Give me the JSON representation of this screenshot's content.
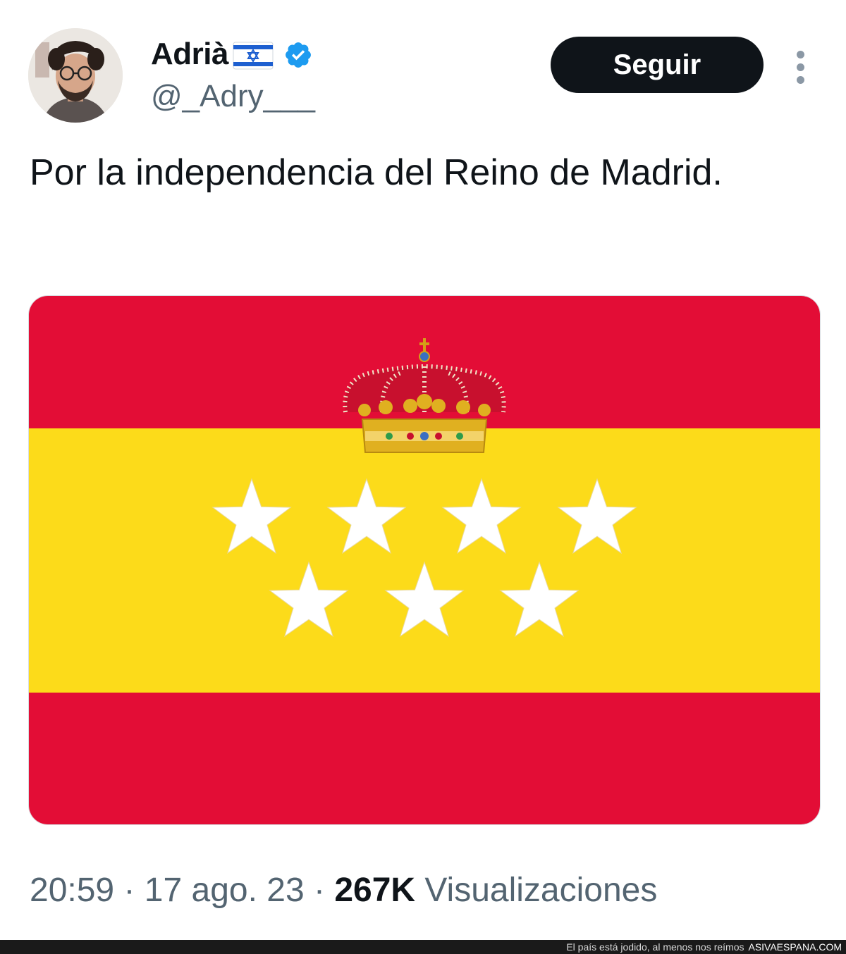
{
  "author": {
    "display_name": "Adrià",
    "name_flag_icon": "israel-flag-icon",
    "verified_icon": "verified-badge-icon",
    "handle": "@_Adry___"
  },
  "follow_button": {
    "label": "Seguir"
  },
  "more_menu": {
    "icon": "more-vertical-icon"
  },
  "tweet": {
    "text": "Por la independencia del Reino de Madrid.",
    "media": {
      "description_icon": "flag-image",
      "colors": {
        "red": "#e30d36",
        "yellow": "#fcdb1a",
        "star": "#ffffff"
      }
    }
  },
  "meta": {
    "time": "20:59",
    "separator": " · ",
    "date": "17 ago. 23",
    "views_count": "267K",
    "views_label": " Visualizaciones"
  },
  "footer": {
    "slogan": "El país está jodido, al menos nos reímos",
    "site": "ASIVAESPANA.COM"
  },
  "colors": {
    "text_primary": "#0f1419",
    "text_secondary": "#536471",
    "follow_bg": "#0f1419",
    "verified_blue": "#1d9bf0"
  }
}
